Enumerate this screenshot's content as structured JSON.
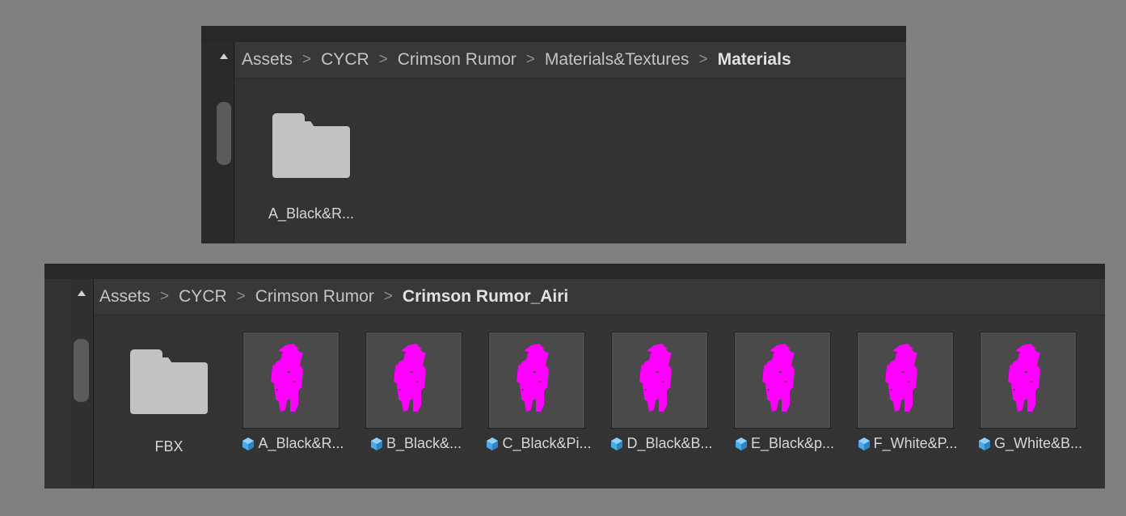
{
  "colors": {
    "background": "#808080",
    "panel": "#333333",
    "breadcrumb_bar": "#383838",
    "thumbnail_bg": "#4a4a4a",
    "missing_material_magenta": "#ff00ff",
    "prefab_icon_blue": "#4aa8e8",
    "folder_icon": "#c2c2c2"
  },
  "panel_top": {
    "breadcrumb": [
      "Assets",
      "CYCR",
      "Crimson Rumor",
      "Materials&Textures",
      "Materials"
    ],
    "items": [
      {
        "type": "folder",
        "icon": "folder-icon",
        "label": "A_Black&R..."
      }
    ]
  },
  "panel_bottom": {
    "breadcrumb": [
      "Assets",
      "CYCR",
      "Crimson Rumor",
      "Crimson Rumor_Airi"
    ],
    "items": [
      {
        "type": "folder",
        "icon": "folder-icon",
        "label": "FBX"
      },
      {
        "type": "prefab",
        "icon": "prefab-cube-icon",
        "label": "A_Black&R..."
      },
      {
        "type": "prefab",
        "icon": "prefab-cube-icon",
        "label": "B_Black&..."
      },
      {
        "type": "prefab",
        "icon": "prefab-cube-icon",
        "label": "C_Black&Pi..."
      },
      {
        "type": "prefab",
        "icon": "prefab-cube-icon",
        "label": "D_Black&B..."
      },
      {
        "type": "prefab",
        "icon": "prefab-cube-icon",
        "label": "E_Black&p..."
      },
      {
        "type": "prefab",
        "icon": "prefab-cube-icon",
        "label": "F_White&P..."
      },
      {
        "type": "prefab",
        "icon": "prefab-cube-icon",
        "label": "G_White&B..."
      }
    ]
  }
}
